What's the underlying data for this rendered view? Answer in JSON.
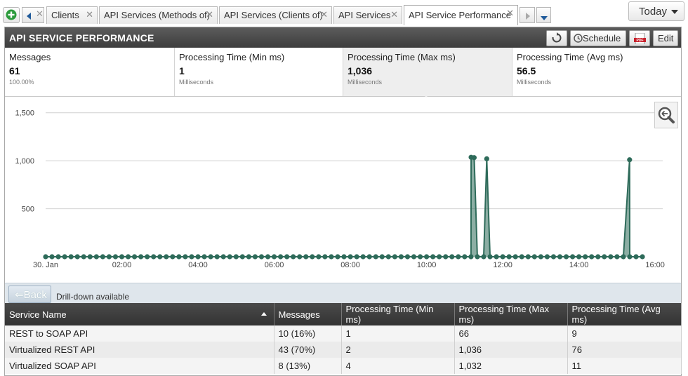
{
  "tabs": [
    {
      "label": "Clients"
    },
    {
      "label": "API Services (Methods of)"
    },
    {
      "label": "API Services (Clients of)"
    },
    {
      "label": "API Services"
    },
    {
      "label": "API Service Performance"
    }
  ],
  "date_range": "Today",
  "panel": {
    "title": "API SERVICE PERFORMANCE",
    "schedule_label": "Schedule",
    "edit_label": "Edit"
  },
  "kpis": [
    {
      "label": "Messages",
      "value": "61",
      "sub": "100.00%"
    },
    {
      "label": "Processing Time (Min ms)",
      "value": "1",
      "sub": "Milliseconds"
    },
    {
      "label": "Processing Time (Max ms)",
      "value": "1,036",
      "sub": "Milliseconds"
    },
    {
      "label": "Processing Time (Avg ms)",
      "value": "56.5",
      "sub": "Milliseconds"
    }
  ],
  "chart_data": {
    "type": "area",
    "xlabel": "",
    "ylabel": "",
    "ylim": [
      0,
      1600
    ],
    "y_ticks": [
      "1,500",
      "1,000",
      "500"
    ],
    "y_tick_values": [
      1500,
      1000,
      500
    ],
    "x_ticks": [
      "30. Jan",
      "02:00",
      "04:00",
      "06:00",
      "08:00",
      "10:00",
      "12:00",
      "14:00",
      "16:00"
    ],
    "x_tick_hours": [
      0,
      2,
      4,
      6,
      8,
      10,
      12,
      14,
      16
    ],
    "xlim_hours": [
      0,
      16.2
    ],
    "sample_step_minutes": 10,
    "nonzero_points": [
      {
        "hour": 11.17,
        "value": 1036
      },
      {
        "hour": 11.25,
        "value": 1032
      },
      {
        "hour": 11.58,
        "value": 1020
      },
      {
        "hour": 15.33,
        "value": 1010
      }
    ],
    "color": "#2e6b5a"
  },
  "drilldown": {
    "back_label": "Back",
    "text": "Drill-down available"
  },
  "table": {
    "columns": [
      "Service Name",
      "Messages",
      "Processing Time (Min ms)",
      "Processing Time (Max ms)",
      "Processing Time (Avg ms)"
    ],
    "rows": [
      [
        "REST to SOAP API",
        "10 (16%)",
        "1",
        "66",
        "9"
      ],
      [
        "Virtualized REST API",
        "43 (70%)",
        "2",
        "1,036",
        "76"
      ],
      [
        "Virtualized SOAP API",
        "8 (13%)",
        "4",
        "1,032",
        "11"
      ]
    ]
  }
}
